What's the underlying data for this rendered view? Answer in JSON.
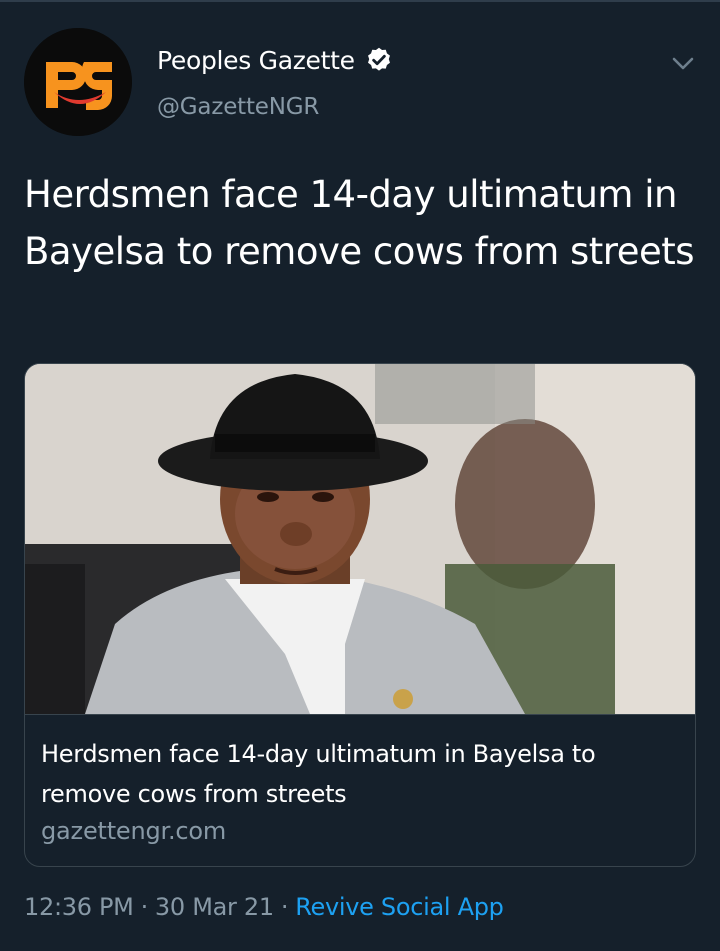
{
  "account": {
    "display_name": "Peoples Gazette",
    "handle": "@GazetteNGR",
    "avatar_text": "pg",
    "verified": true
  },
  "tweet": {
    "text": "Herdsmen face 14-day ultimatum in Bayelsa to remove cows from streets"
  },
  "card": {
    "title": "Herdsmen face 14-day ultimatum in Bayelsa to remove cows from streets",
    "domain": "gazettengr.com"
  },
  "meta": {
    "time": "12:36 PM",
    "date": "30 Mar 21",
    "separator": "·",
    "source": "Revive Social App"
  },
  "icons": {
    "more": "chevron-down-icon",
    "verified": "verified-badge-icon"
  },
  "colors": {
    "background": "#15202b",
    "secondary_text": "#8899a6",
    "link": "#1da1f2",
    "border": "#38444d",
    "brand_orange": "#f7931e"
  }
}
